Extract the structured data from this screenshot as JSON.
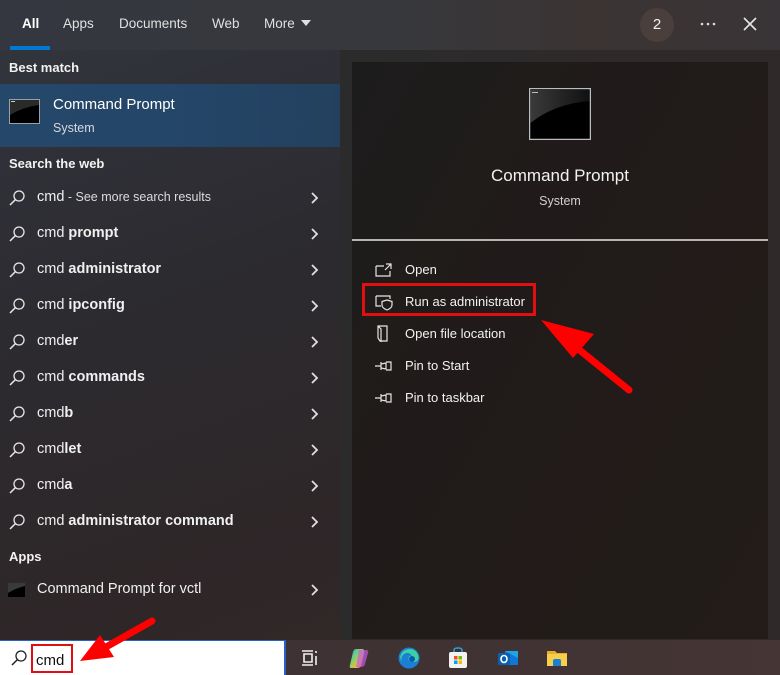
{
  "tabs": [
    {
      "label": "All",
      "active": true
    },
    {
      "label": "Apps"
    },
    {
      "label": "Documents"
    },
    {
      "label": "Web"
    },
    {
      "label": "More"
    }
  ],
  "header": {
    "badge_count": "2",
    "more_options_icon": "ellipsis-icon",
    "close_icon": "close-icon"
  },
  "left": {
    "best_match_heading": "Best match",
    "best_match": {
      "title": "Command Prompt",
      "subtitle": "System",
      "icon": "command-prompt-icon"
    },
    "web_heading": "Search the web",
    "web_results": [
      {
        "normal": "cmd",
        "bold": "",
        "suffix": " - See more search results"
      },
      {
        "normal": "cmd ",
        "bold": "prompt",
        "suffix": ""
      },
      {
        "normal": "cmd ",
        "bold": "administrator",
        "suffix": ""
      },
      {
        "normal": "cmd ",
        "bold": "ipconfig",
        "suffix": ""
      },
      {
        "normal": "cmd",
        "bold": "er",
        "suffix": ""
      },
      {
        "normal": "cmd ",
        "bold": "commands",
        "suffix": ""
      },
      {
        "normal": "cmd",
        "bold": "b",
        "suffix": ""
      },
      {
        "normal": "cmd",
        "bold": "let",
        "suffix": ""
      },
      {
        "normal": "cmd",
        "bold": "a",
        "suffix": ""
      },
      {
        "normal": "cmd ",
        "bold": "administrator command",
        "suffix": ""
      }
    ],
    "apps_heading": "Apps",
    "apps": [
      {
        "label": "Command Prompt for vctl",
        "icon": "command-prompt-icon"
      }
    ]
  },
  "right": {
    "title": "Command Prompt",
    "subtitle": "System",
    "actions": [
      {
        "label": "Open",
        "icon": "open-icon"
      },
      {
        "label": "Run as administrator",
        "icon": "shield-icon"
      },
      {
        "label": "Open file location",
        "icon": "file-location-icon"
      },
      {
        "label": "Pin to Start",
        "icon": "pin-icon"
      },
      {
        "label": "Pin to taskbar",
        "icon": "pin-icon"
      }
    ]
  },
  "taskbar": {
    "search_value": "cmd",
    "search_placeholder": "",
    "icons": [
      "task-view-icon",
      "copilot-icon",
      "edge-icon",
      "store-icon",
      "outlook-icon",
      "file-explorer-icon"
    ]
  },
  "annotations": {
    "highlight_color": "#e10f0f",
    "accent_color": "#0078d4",
    "selected_row_color": "#25486a"
  }
}
